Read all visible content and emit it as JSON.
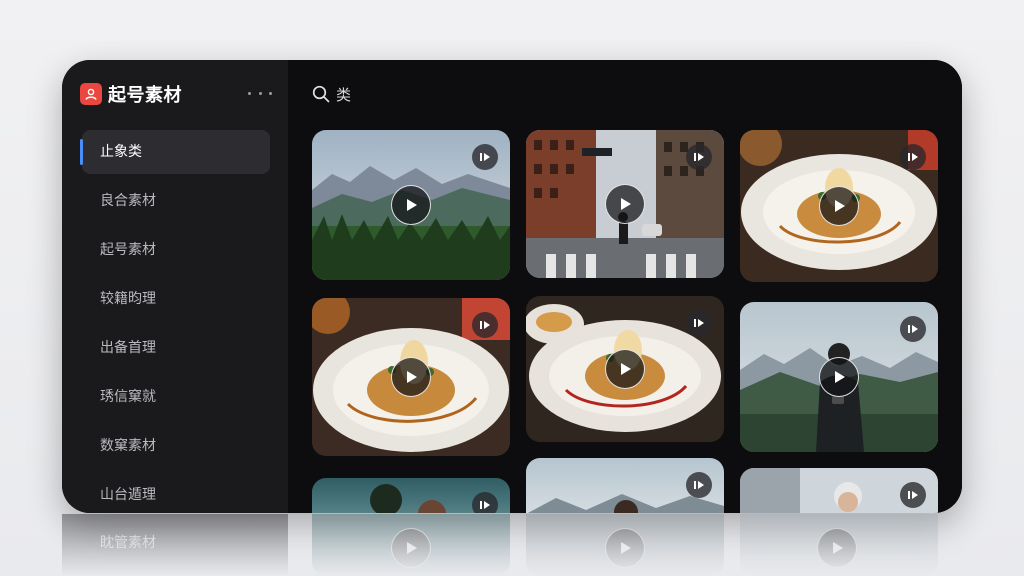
{
  "app": {
    "title": "起号素材",
    "logo_icon": "app-logo-icon",
    "more_icon": "more-dots-icon"
  },
  "search": {
    "label": "类",
    "icon": "search-icon"
  },
  "sidebar": {
    "items": [
      {
        "label": "止象类",
        "active": true
      },
      {
        "label": "良合素材",
        "active": false
      },
      {
        "label": "起号素材",
        "active": false
      },
      {
        "label": "较籍昀理",
        "active": false
      },
      {
        "label": "出备首理",
        "active": false
      },
      {
        "label": "琇信窠就",
        "active": false
      },
      {
        "label": "数窠素材",
        "active": false
      },
      {
        "label": "山台遁理",
        "active": false
      }
    ],
    "reflection_label": "眈管素材"
  },
  "grid": {
    "tiles": [
      {
        "scene": "mountain-forest",
        "badge_icon": "video-badge-icon",
        "play_icon": "play-icon"
      },
      {
        "scene": "city-street-walker",
        "badge_icon": "video-badge-icon",
        "play_icon": "play-icon"
      },
      {
        "scene": "food-plate",
        "badge_icon": "video-badge-icon",
        "play_icon": "play-icon"
      },
      {
        "scene": "food-plate",
        "badge_icon": "video-badge-icon",
        "play_icon": "play-icon"
      },
      {
        "scene": "food-plate",
        "badge_icon": "video-badge-icon",
        "play_icon": "play-icon"
      },
      {
        "scene": "person-mountains",
        "badge_icon": "video-badge-icon",
        "play_icon": "play-icon"
      },
      {
        "scene": "person-teal",
        "badge_icon": "video-badge-icon",
        "play_icon": "play-icon"
      },
      {
        "scene": "woman-mountains",
        "badge_icon": "video-badge-icon",
        "play_icon": "play-icon"
      },
      {
        "scene": "woman-beanie",
        "badge_icon": "video-badge-icon",
        "play_icon": "play-icon"
      }
    ]
  },
  "colors": {
    "accent": "#4b8df8",
    "brand": "#e9473f",
    "panel": "#0d0d0f",
    "sidebar": "#1a1a1d"
  }
}
